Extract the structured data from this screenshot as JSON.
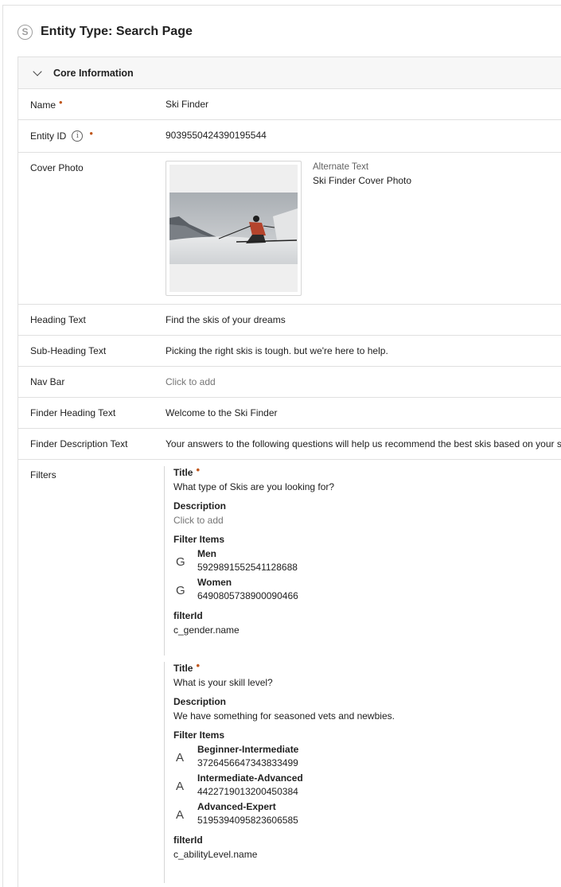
{
  "header": {
    "icon_letter": "S",
    "title": "Entity Type: Search Page"
  },
  "section": {
    "title": "Core Information"
  },
  "fields": {
    "name": {
      "label": "Name",
      "value": "Ski Finder"
    },
    "entity_id": {
      "label": "Entity ID",
      "value": "9039550424390195544"
    },
    "cover_photo": {
      "label": "Cover Photo",
      "alt_label": "Alternate Text",
      "alt_value": "Ski Finder Cover Photo"
    },
    "heading_text": {
      "label": "Heading Text",
      "value": "Find the skis of your dreams"
    },
    "sub_heading_text": {
      "label": "Sub-Heading Text",
      "value": "Picking the right skis is tough. but we're here to help."
    },
    "nav_bar": {
      "label": "Nav Bar",
      "placeholder": "Click to add"
    },
    "finder_heading_text": {
      "label": "Finder Heading Text",
      "value": "Welcome to the Ski Finder"
    },
    "finder_description_text": {
      "label": "Finder Description Text",
      "value": "Your answers to the following questions will help us recommend the best skis based on your sk"
    },
    "filters": {
      "label": "Filters"
    }
  },
  "labels": {
    "title": "Title",
    "description": "Description",
    "filter_items": "Filter Items",
    "filter_id": "filterId",
    "required_mark": "•",
    "info_glyph": "i"
  },
  "filters": [
    {
      "title": "What type of Skis are you looking for?",
      "description": "Click to add",
      "description_is_placeholder": true,
      "items": [
        {
          "icon": "G",
          "name": "Men",
          "id": "5929891552541128688"
        },
        {
          "icon": "G",
          "name": "Women",
          "id": "6490805738900090466"
        }
      ],
      "filter_id": "c_gender.name"
    },
    {
      "title": "What is your skill level?",
      "description": "We have something for seasoned vets and newbies.",
      "description_is_placeholder": false,
      "items": [
        {
          "icon": "A",
          "name": "Beginner-Intermediate",
          "id": "3726456647343833499"
        },
        {
          "icon": "A",
          "name": "Intermediate-Advanced",
          "id": "4422719013200450384"
        },
        {
          "icon": "A",
          "name": "Advanced-Expert",
          "id": "5195394095823606585"
        }
      ],
      "filter_id": "c_abilityLevel.name"
    }
  ],
  "colors": {
    "required": "#c0571c",
    "border": "#e0e0e0",
    "header_bg": "#f7f7f7",
    "placeholder": "#757575"
  },
  "icons": {
    "header": "circled-s-icon",
    "collapse": "chevron-down-icon",
    "info": "info-circle-icon"
  }
}
